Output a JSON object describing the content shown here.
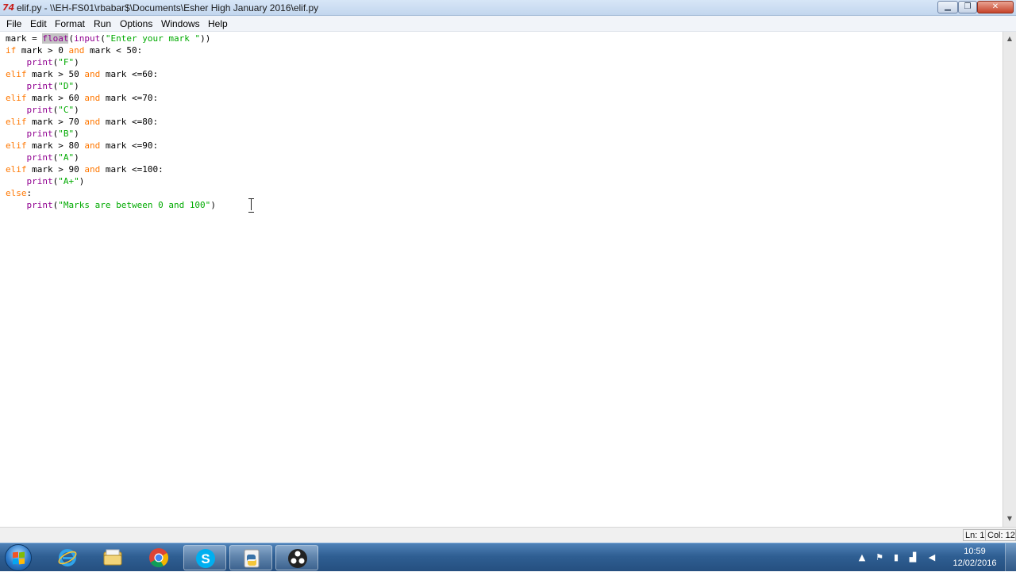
{
  "window": {
    "app_icon": "74",
    "title": "elif.py - \\\\EH-FS01\\rbabar$\\Documents\\Esher High January 2016\\elif.py",
    "min_glyph": "▁",
    "max_glyph": "❐",
    "close_glyph": "✕"
  },
  "menu": {
    "items": [
      "File",
      "Edit",
      "Format",
      "Run",
      "Options",
      "Windows",
      "Help"
    ]
  },
  "editor": {
    "lines": [
      [
        {
          "t": "mark = ",
          "c": ""
        },
        {
          "t": "float",
          "c": "bi sel"
        },
        {
          "t": "(",
          "c": ""
        },
        {
          "t": "input",
          "c": "bi"
        },
        {
          "t": "(",
          "c": ""
        },
        {
          "t": "\"Enter your mark \"",
          "c": "st"
        },
        {
          "t": "))",
          "c": ""
        }
      ],
      [
        {
          "t": "if",
          "c": "kw"
        },
        {
          "t": " mark > 0 ",
          "c": ""
        },
        {
          "t": "and",
          "c": "kw"
        },
        {
          "t": " mark < 50:",
          "c": ""
        }
      ],
      [
        {
          "t": "    ",
          "c": ""
        },
        {
          "t": "print",
          "c": "bi"
        },
        {
          "t": "(",
          "c": ""
        },
        {
          "t": "\"F\"",
          "c": "st"
        },
        {
          "t": ")",
          "c": ""
        }
      ],
      [
        {
          "t": "elif",
          "c": "kw"
        },
        {
          "t": " mark > 50 ",
          "c": ""
        },
        {
          "t": "and",
          "c": "kw"
        },
        {
          "t": " mark <=60:",
          "c": ""
        }
      ],
      [
        {
          "t": "    ",
          "c": ""
        },
        {
          "t": "print",
          "c": "bi"
        },
        {
          "t": "(",
          "c": ""
        },
        {
          "t": "\"D\"",
          "c": "st"
        },
        {
          "t": ")",
          "c": ""
        }
      ],
      [
        {
          "t": "elif",
          "c": "kw"
        },
        {
          "t": " mark > 60 ",
          "c": ""
        },
        {
          "t": "and",
          "c": "kw"
        },
        {
          "t": " mark <=70:",
          "c": ""
        }
      ],
      [
        {
          "t": "    ",
          "c": ""
        },
        {
          "t": "print",
          "c": "bi"
        },
        {
          "t": "(",
          "c": ""
        },
        {
          "t": "\"C\"",
          "c": "st"
        },
        {
          "t": ")",
          "c": ""
        }
      ],
      [
        {
          "t": "elif",
          "c": "kw"
        },
        {
          "t": " mark > 70 ",
          "c": ""
        },
        {
          "t": "and",
          "c": "kw"
        },
        {
          "t": " mark <=80:",
          "c": ""
        }
      ],
      [
        {
          "t": "    ",
          "c": ""
        },
        {
          "t": "print",
          "c": "bi"
        },
        {
          "t": "(",
          "c": ""
        },
        {
          "t": "\"B\"",
          "c": "st"
        },
        {
          "t": ")",
          "c": ""
        }
      ],
      [
        {
          "t": "elif",
          "c": "kw"
        },
        {
          "t": " mark > 80 ",
          "c": ""
        },
        {
          "t": "and",
          "c": "kw"
        },
        {
          "t": " mark <=90:",
          "c": ""
        }
      ],
      [
        {
          "t": "    ",
          "c": ""
        },
        {
          "t": "print",
          "c": "bi"
        },
        {
          "t": "(",
          "c": ""
        },
        {
          "t": "\"A\"",
          "c": "st"
        },
        {
          "t": ")",
          "c": ""
        }
      ],
      [
        {
          "t": "elif",
          "c": "kw"
        },
        {
          "t": " mark > 90 ",
          "c": ""
        },
        {
          "t": "and",
          "c": "kw"
        },
        {
          "t": " mark <=100:",
          "c": ""
        }
      ],
      [
        {
          "t": "    ",
          "c": ""
        },
        {
          "t": "print",
          "c": "bi"
        },
        {
          "t": "(",
          "c": ""
        },
        {
          "t": "\"A+\"",
          "c": "st"
        },
        {
          "t": ")",
          "c": ""
        }
      ],
      [
        {
          "t": "else",
          "c": "kw"
        },
        {
          "t": ":",
          "c": ""
        }
      ],
      [
        {
          "t": "    ",
          "c": ""
        },
        {
          "t": "print",
          "c": "bi"
        },
        {
          "t": "(",
          "c": ""
        },
        {
          "t": "\"Marks are between 0 and 100\"",
          "c": "st"
        },
        {
          "t": ")",
          "c": ""
        }
      ]
    ],
    "colors": {
      "keyword": "#ff7700",
      "builtin": "#900090",
      "string": "#00aa00"
    }
  },
  "status": {
    "line": "Ln: 1",
    "col": "Col: 12"
  },
  "taskbar": {
    "icons": [
      "windows-start-icon",
      "internet-explorer-icon",
      "file-explorer-icon",
      "chrome-icon",
      "skype-icon",
      "python-idle-icon",
      "obs-icon"
    ],
    "clock_time": "10:59",
    "clock_date": "12/02/2016"
  }
}
